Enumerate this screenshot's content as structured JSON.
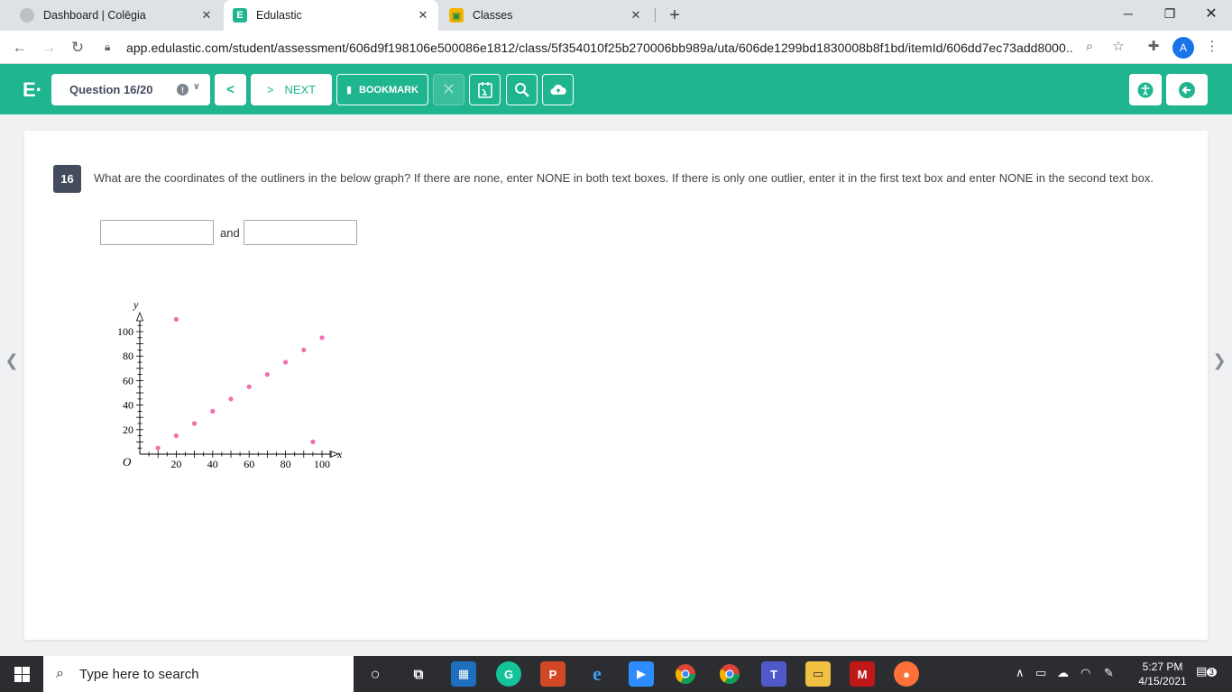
{
  "browser": {
    "tabs": [
      {
        "title": "Dashboard | Colēgia"
      },
      {
        "title": "Edulastic"
      },
      {
        "title": "Classes"
      }
    ],
    "url": "app.edulastic.com/student/assessment/606d9f198106e500086e1812/class/5f354010f25b270006bb989a/uta/606de1299bd1830008b8f1bd/itemId/606dd7ec73add8000...",
    "profile_initial": "A"
  },
  "toolbar": {
    "logo": "E·",
    "question_selector": "Question 16/20",
    "next_label": "NEXT",
    "bookmark_label": "BOOKMARK"
  },
  "question": {
    "number": "16",
    "text": "What are the coordinates of the outliners in the below graph?  If there are none, enter NONE in both text boxes.  If there is only one outlier, enter it in the first text box and enter NONE in the second text box.",
    "and_label": "and",
    "answer1": "",
    "answer2": ""
  },
  "chart_data": {
    "type": "scatter",
    "xlabel": "x",
    "ylabel": "y",
    "origin_label": "O",
    "x_ticks": [
      "20",
      "40",
      "60",
      "80",
      "100"
    ],
    "y_ticks": [
      "20",
      "40",
      "60",
      "80",
      "100"
    ],
    "xlim": [
      0,
      110
    ],
    "ylim": [
      0,
      115
    ],
    "point_color": "#f06fb0",
    "points": [
      {
        "x": 10,
        "y": 5
      },
      {
        "x": 20,
        "y": 110
      },
      {
        "x": 20,
        "y": 15
      },
      {
        "x": 30,
        "y": 25
      },
      {
        "x": 40,
        "y": 35
      },
      {
        "x": 50,
        "y": 45
      },
      {
        "x": 60,
        "y": 55
      },
      {
        "x": 70,
        "y": 65
      },
      {
        "x": 80,
        "y": 75
      },
      {
        "x": 90,
        "y": 85
      },
      {
        "x": 95,
        "y": 10
      },
      {
        "x": 100,
        "y": 95
      }
    ]
  },
  "taskbar": {
    "search_placeholder": "Type here to search",
    "time": "5:27 PM",
    "date": "4/15/2021",
    "notification_count": "3"
  },
  "colors": {
    "brand": "#1fb58f",
    "question_badge": "#434b5d"
  }
}
